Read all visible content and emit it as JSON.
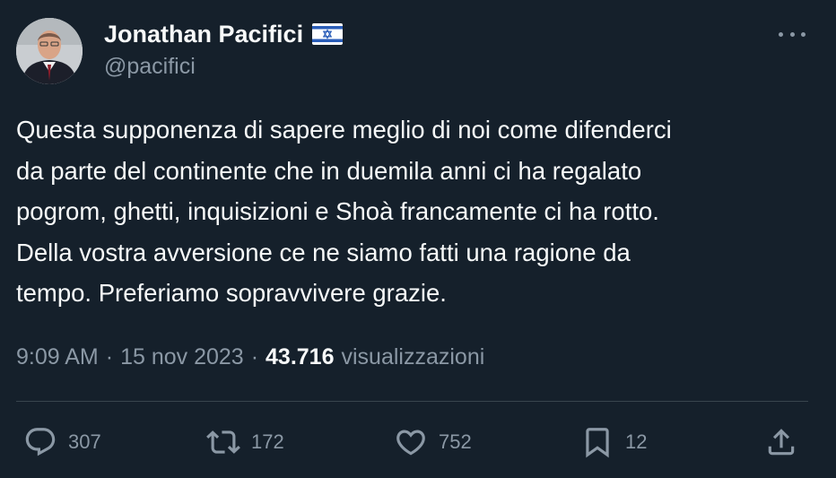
{
  "tweet": {
    "author": {
      "name": "Jonathan Pacifici",
      "handle": "@pacifici"
    },
    "text": "Questa supponenza di sapere meglio di noi come difenderci\nda parte del continente che in duemila anni ci ha regalato\npogrom, ghetti, inquisizioni e Shoà francamente ci ha rotto.\nDella vostra avversione ce ne siamo fatti una ragione da\ntempo. Preferiamo sopravvivere grazie.",
    "time": "9:09 AM",
    "separator": "·",
    "date": "15 nov 2023",
    "views_count": "43.716",
    "views_label": "visualizzazioni"
  },
  "actions": {
    "replies": "307",
    "retweets": "172",
    "likes": "752",
    "bookmarks": "12"
  },
  "colors": {
    "background": "#15202b",
    "text_primary": "#f7f9f9",
    "text_secondary": "#8b98a5",
    "divider": "#38444d"
  },
  "icons": [
    "avatar",
    "israel-flag-icon",
    "more-options-icon",
    "reply-icon",
    "retweet-icon",
    "like-icon",
    "bookmark-icon",
    "share-icon"
  ]
}
